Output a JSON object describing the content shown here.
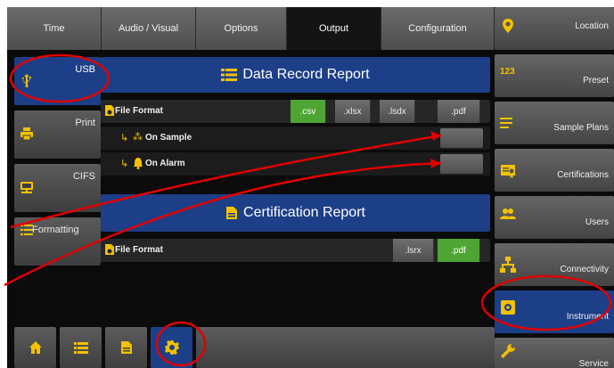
{
  "top_tabs": [
    {
      "label": "Time"
    },
    {
      "label": "Audio / Visual"
    },
    {
      "label": "Options"
    },
    {
      "label": "Output",
      "active": true
    },
    {
      "label": "Configuration"
    }
  ],
  "left_nav": [
    {
      "label": "USB",
      "icon": "usb-icon",
      "active": true
    },
    {
      "label": "Print",
      "icon": "printer-icon"
    },
    {
      "label": "CIFS",
      "icon": "network-folder-icon"
    },
    {
      "label": "Formatting",
      "icon": "list-format-icon"
    }
  ],
  "data_record_report": {
    "title": "Data Record Report",
    "file_format_label": "File Format",
    "formats": [
      {
        "label": ".csv",
        "selected": true
      },
      {
        "label": ".xlsx",
        "selected": false
      },
      {
        "label": ".lsdx",
        "selected": false
      },
      {
        "label": ".pdf",
        "selected": false
      }
    ],
    "on_sample_label": "On Sample",
    "on_alarm_label": "On Alarm",
    "on_sample_checked": false,
    "on_alarm_checked": false
  },
  "certification_report": {
    "title": "Certification Report",
    "file_format_label": "File Format",
    "formats": [
      {
        "label": ".lsrx",
        "selected": false
      },
      {
        "label": ".pdf",
        "selected": true
      }
    ]
  },
  "right_nav": [
    {
      "label": "Location",
      "icon": "location-pin-icon"
    },
    {
      "label": "Preset",
      "icon": "numbers-icon",
      "icon_text": "123"
    },
    {
      "label": "Sample Plans",
      "icon": "list-lines-icon"
    },
    {
      "label": "Certifications",
      "icon": "certificate-icon"
    },
    {
      "label": "Users",
      "icon": "users-icon"
    },
    {
      "label": "Connectivity",
      "icon": "network-icon"
    },
    {
      "label": "Instrument",
      "icon": "instrument-icon",
      "active": true
    },
    {
      "label": "Service",
      "icon": "wrench-icon"
    }
  ],
  "bottom_bar": [
    {
      "icon": "home-icon"
    },
    {
      "icon": "list-icon"
    },
    {
      "icon": "document-icon"
    },
    {
      "icon": "settings-gear-icon",
      "active": true
    }
  ],
  "colors": {
    "accent_blue": "#1d3f88",
    "selected_green": "#4ea534",
    "icon_yellow": "#f2c200",
    "annotation_red": "#e00000"
  }
}
